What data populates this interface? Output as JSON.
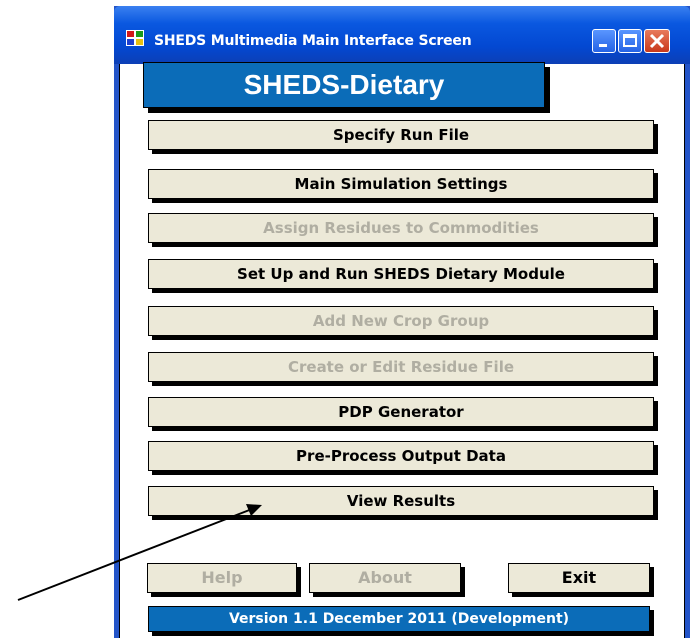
{
  "window": {
    "title": "SHEDS Multimedia Main Interface Screen",
    "controls": [
      "minimize-icon",
      "maximize-icon",
      "close-icon"
    ]
  },
  "banner": {
    "text": "SHEDS-Dietary"
  },
  "menu": {
    "buttons": [
      {
        "label": "Specify Run File",
        "enabled": true
      },
      {
        "label": "Main Simulation Settings",
        "enabled": true
      },
      {
        "label": "Assign Residues to Commodities",
        "enabled": false
      },
      {
        "label": "Set Up and Run SHEDS Dietary Module",
        "enabled": true
      },
      {
        "label": "Add New Crop Group",
        "enabled": false
      },
      {
        "label": "Create or Edit Residue File",
        "enabled": false
      },
      {
        "label": "PDP Generator",
        "enabled": true
      },
      {
        "label": "Pre-Process Output Data",
        "enabled": true
      },
      {
        "label": "View Results",
        "enabled": true
      }
    ]
  },
  "footer": {
    "help_label": "Help",
    "about_label": "About",
    "exit_label": "Exit"
  },
  "version_text": "Version 1.1 December 2011 (Development)",
  "colors": {
    "titlebar": "#0a58e0",
    "banner": "#0b6cb8",
    "button_face": "#ece9d8",
    "disabled_text": "#b0aea2"
  }
}
